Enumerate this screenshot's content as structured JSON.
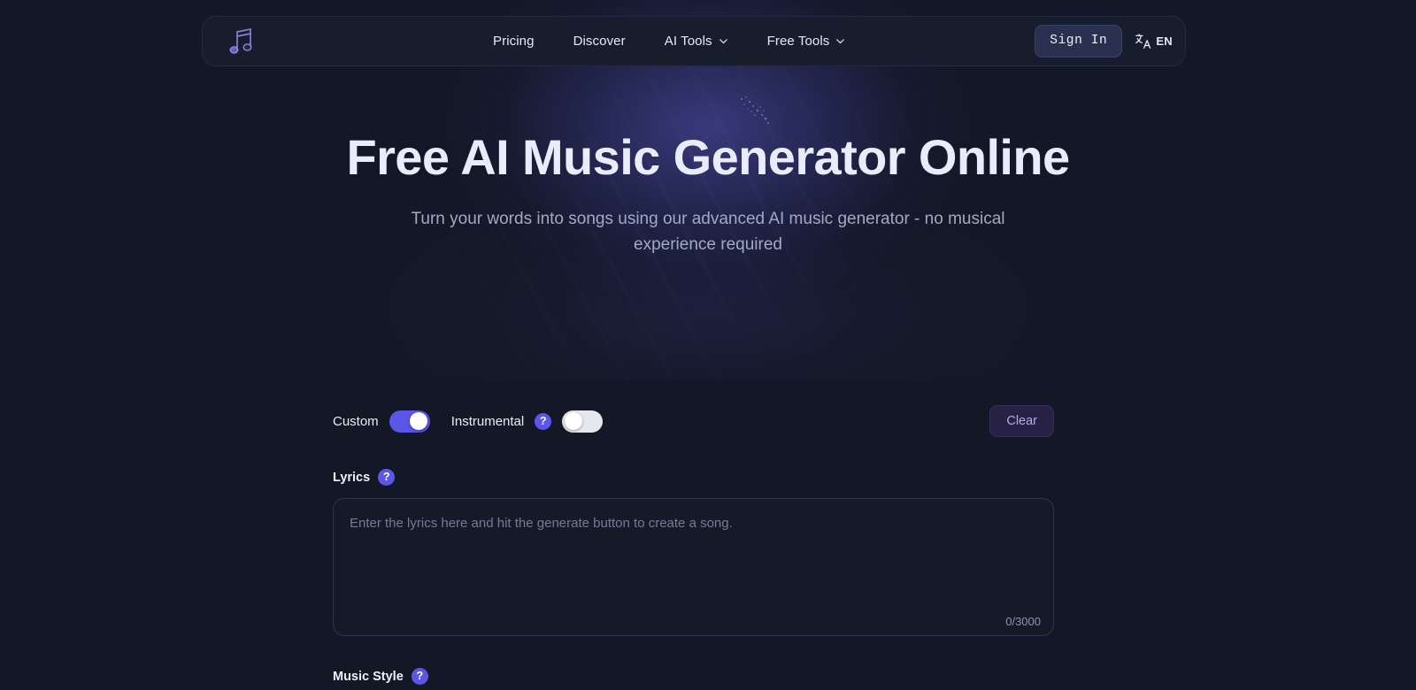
{
  "brand": {
    "logo_icon": "music-note-icon"
  },
  "nav": {
    "links": [
      {
        "label": "Pricing",
        "has_chevron": false
      },
      {
        "label": "Discover",
        "has_chevron": false
      },
      {
        "label": "AI Tools",
        "has_chevron": true
      },
      {
        "label": "Free Tools",
        "has_chevron": true
      }
    ],
    "sign_in_label": "Sign In",
    "language_code": "EN",
    "language_icon": "translate-icon"
  },
  "hero": {
    "title": "Free AI Music Generator Online",
    "subtitle": "Turn your words into songs using our advanced AI music generator - no musical experience required"
  },
  "generator": {
    "custom": {
      "label": "Custom",
      "state": "on"
    },
    "instrumental": {
      "label": "Instrumental",
      "state": "off",
      "help_icon": "question-mark-icon"
    },
    "clear_label": "Clear",
    "lyrics": {
      "label": "Lyrics",
      "help_icon": "question-mark-icon",
      "value": "",
      "placeholder": "Enter the lyrics here and hit the generate button to create a song.",
      "counter": "0/3000",
      "max_length": "3000"
    },
    "music_style": {
      "label": "Music Style",
      "help_icon": "question-mark-icon"
    }
  },
  "colors": {
    "page_background": "#141826",
    "navbar_background": "#181d2e",
    "accent_purple": "#5b55e8",
    "clear_button_text": "#b9a8f2",
    "heading_text": "#e9ecfb",
    "subtitle_text": "#a3a9c4",
    "placeholder_text": "#747b99"
  }
}
